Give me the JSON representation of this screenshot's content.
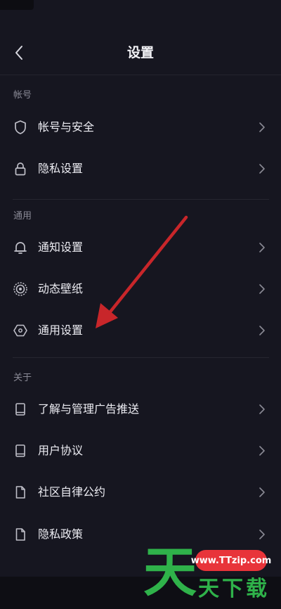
{
  "header": {
    "title": "设置",
    "back_icon": "chevron-left-icon"
  },
  "sections": {
    "account": {
      "title": "帐号",
      "items": [
        {
          "label": "帐号与安全",
          "icon": "shield-icon"
        },
        {
          "label": "隐私设置",
          "icon": "lock-icon"
        }
      ]
    },
    "general": {
      "title": "通用",
      "items": [
        {
          "label": "通知设置",
          "icon": "bell-icon"
        },
        {
          "label": "动态壁纸",
          "icon": "target-icon"
        },
        {
          "label": "通用设置",
          "icon": "hexagon-icon"
        }
      ]
    },
    "about": {
      "title": "关于",
      "items": [
        {
          "label": "了解与管理广告推送",
          "icon": "book-icon"
        },
        {
          "label": "用户协议",
          "icon": "book-icon"
        },
        {
          "label": "社区自律公约",
          "icon": "document-icon"
        },
        {
          "label": "隐私政策",
          "icon": "document-icon"
        }
      ]
    }
  },
  "watermark": {
    "url": "www.TTzip.com",
    "big_char": "天",
    "small_text": "天下载"
  },
  "colors": {
    "background": "#161620",
    "arrow": "#c8262a",
    "watermark_green": "#2fb24a",
    "watermark_red": "#e8343a"
  }
}
